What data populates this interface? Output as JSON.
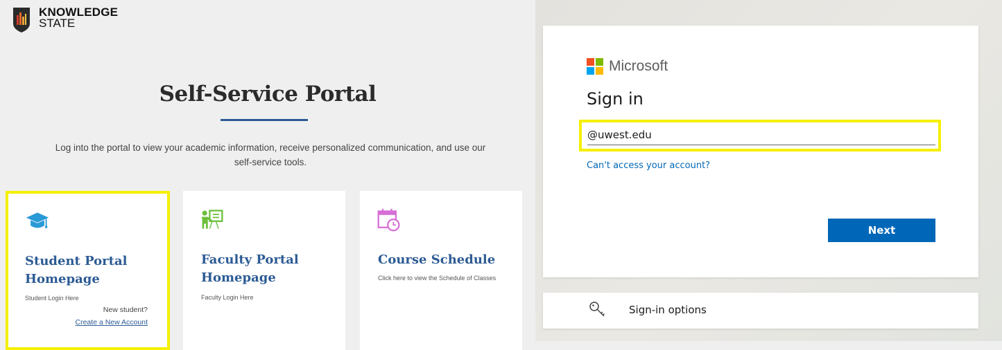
{
  "logo": {
    "line1": "KNOWLEDGE",
    "line2": "STATE"
  },
  "hero": {
    "title": "Self-Service Portal",
    "subtitle": "Log into the portal to view your academic information, receive personalized communication, and use our self-service tools."
  },
  "cards": [
    {
      "icon": "graduation-cap-icon",
      "title": "Student Portal Homepage",
      "desc": "Student Login Here",
      "new_text": "New student?",
      "link": "Create a New Account"
    },
    {
      "icon": "teacher-board-icon",
      "title": "Faculty Portal Homepage",
      "desc": "Faculty Login Here"
    },
    {
      "icon": "calendar-clock-icon",
      "title": "Course Schedule",
      "desc": "Click here to view the Schedule of Classes"
    }
  ],
  "signin": {
    "brand": "Microsoft",
    "title": "Sign in",
    "email_value": "@uwest.edu",
    "cant_access": "Can't access your account?",
    "next": "Next",
    "options": "Sign-in options"
  },
  "colors": {
    "accent_blue": "#2c5b94",
    "ms_blue": "#0067b8",
    "highlight": "#f5ef00"
  }
}
